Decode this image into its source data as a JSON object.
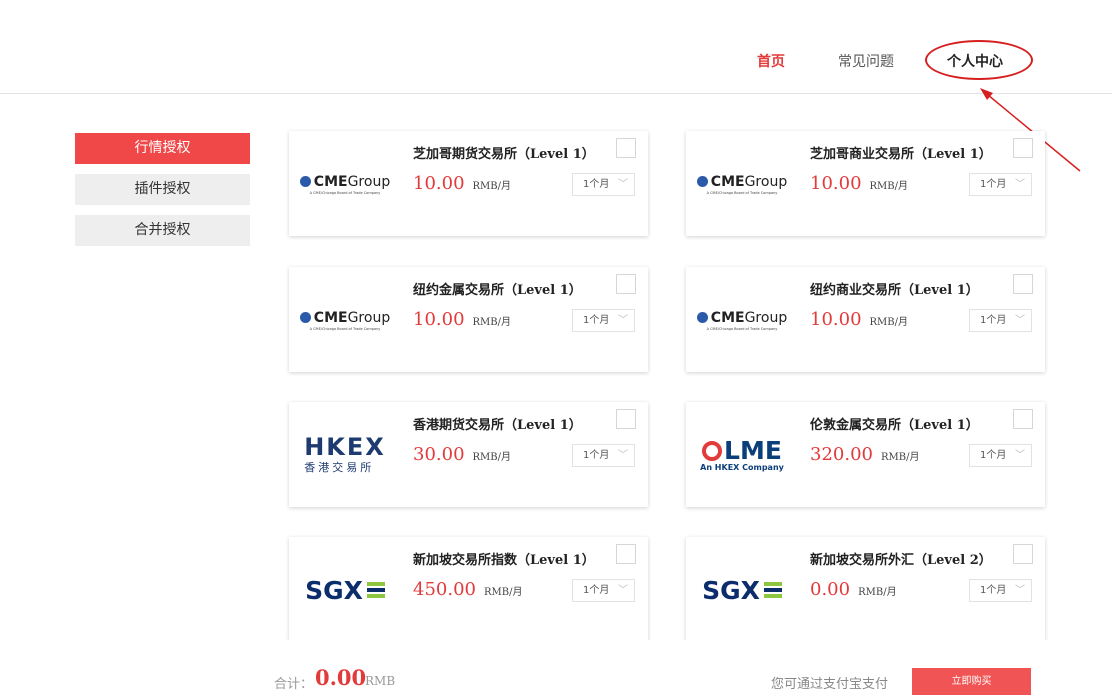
{
  "nav": {
    "home": "首页",
    "faq": "常见问题",
    "profile": "个人中心"
  },
  "sidebar": {
    "items": [
      {
        "label": "行情授权",
        "active": true
      },
      {
        "label": "插件授权",
        "active": false
      },
      {
        "label": "合并授权",
        "active": false
      }
    ]
  },
  "cards": [
    {
      "title": "芝加哥期货交易所（Level 1）",
      "price": "10.00",
      "unit": "RMB/月",
      "period": "1个月",
      "logo": "cme-group-logo"
    },
    {
      "title": "芝加哥商业交易所（Level 1）",
      "price": "10.00",
      "unit": "RMB/月",
      "period": "1个月",
      "logo": "cme-group-logo"
    },
    {
      "title": "纽约金属交易所（Level 1）",
      "price": "10.00",
      "unit": "RMB/月",
      "period": "1个月",
      "logo": "cme-group-logo"
    },
    {
      "title": "纽约商业交易所（Level 1）",
      "price": "10.00",
      "unit": "RMB/月",
      "period": "1个月",
      "logo": "cme-group-logo"
    },
    {
      "title": "香港期货交易所（Level 1）",
      "price": "30.00",
      "unit": "RMB/月",
      "period": "1个月",
      "logo": "hkex-logo"
    },
    {
      "title": "伦敦金属交易所（Level 1）",
      "price": "320.00",
      "unit": "RMB/月",
      "period": "1个月",
      "logo": "lme-logo"
    },
    {
      "title": "新加坡交易所指数（Level 1）",
      "price": "450.00",
      "unit": "RMB/月",
      "period": "1个月",
      "logo": "sgx-logo"
    },
    {
      "title": "新加坡交易所外汇（Level 2）",
      "price": "0.00",
      "unit": "RMB/月",
      "period": "1个月",
      "logo": "sgx-logo"
    }
  ],
  "logos": {
    "cme_word_bold": "CME",
    "cme_word": "Group",
    "cme_sub": "A CME/Chicago Board of Trade Company",
    "hkex_main": "HKEX",
    "hkex_sub": "香港交易所",
    "lme_main": "LME",
    "lme_sub": "An HKEX Company",
    "sgx_main": "SGX"
  },
  "footer": {
    "total_label": "合计：",
    "total_value": "0.00",
    "total_unit": "RMB",
    "pay_note": "您可通过支付宝支付",
    "buy_label": "立即购买"
  },
  "colors": {
    "accent": "#e23b3b",
    "active_tab": "#f04848",
    "buy_button": "#f05454",
    "annotation": "#d62020"
  }
}
